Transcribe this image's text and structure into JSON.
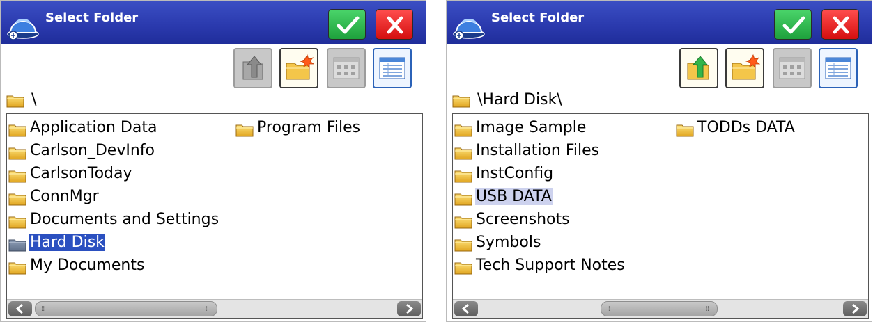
{
  "panels": [
    {
      "title": "Select Folder",
      "current_path": "\\",
      "toolbar": {
        "up_folder": "disabled",
        "new_folder": "enabled",
        "view_icons": "disabled",
        "view_details": "enabled"
      },
      "folders": [
        {
          "label": "Application Data",
          "state": "normal"
        },
        {
          "label": "Carlson_DevInfo",
          "state": "normal"
        },
        {
          "label": "CarlsonToday",
          "state": "normal"
        },
        {
          "label": "ConnMgr",
          "state": "normal"
        },
        {
          "label": "Documents and Settings",
          "state": "normal"
        },
        {
          "label": "Hard Disk",
          "state": "selected"
        },
        {
          "label": "My Documents",
          "state": "normal"
        },
        {
          "label": "Program Files",
          "state": "normal"
        }
      ]
    },
    {
      "title": "Select Folder",
      "current_path": "\\Hard Disk\\",
      "toolbar": {
        "up_folder": "enabled",
        "new_folder": "enabled",
        "view_icons": "disabled",
        "view_details": "enabled"
      },
      "folders": [
        {
          "label": "Image Sample",
          "state": "normal"
        },
        {
          "label": "Installation Files",
          "state": "normal"
        },
        {
          "label": "InstConfig",
          "state": "normal"
        },
        {
          "label": "USB DATA",
          "state": "highlighted"
        },
        {
          "label": "Screenshots",
          "state": "normal"
        },
        {
          "label": "Symbols",
          "state": "normal"
        },
        {
          "label": "Tech Support Notes",
          "state": "normal"
        },
        {
          "label": "TODDs DATA",
          "state": "normal"
        }
      ]
    }
  ],
  "icons": {
    "app": "hardhat-icon",
    "ok": "checkmark-icon",
    "cancel": "close-icon",
    "up": "folder-up-icon",
    "new_folder": "new-folder-icon",
    "icons_view": "icon-view-icon",
    "details_view": "details-view-icon",
    "folder": "folder-icon",
    "scroll_left": "arrow-left-icon",
    "scroll_right": "arrow-right-icon"
  },
  "colors": {
    "titlebar": "#2a39ad",
    "ok_button": "#1ea13c",
    "cancel_button": "#d40f0f",
    "selection": "#2b50c0",
    "highlight": "#cdd2ee"
  }
}
